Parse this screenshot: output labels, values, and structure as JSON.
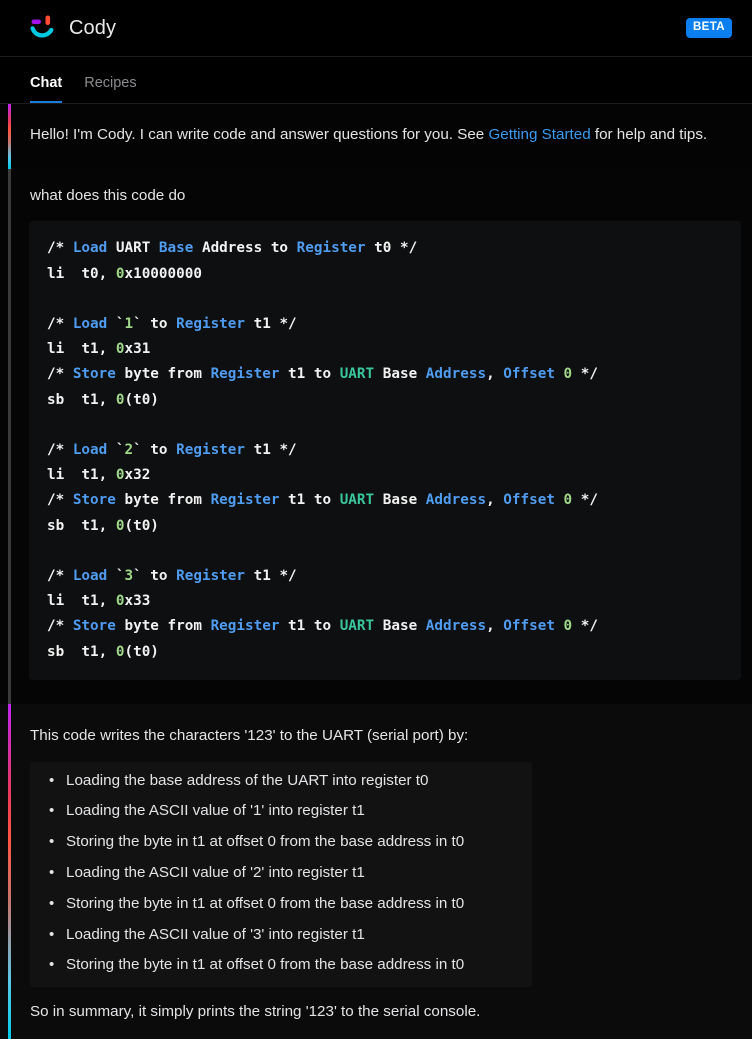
{
  "header": {
    "brand_name": "Cody",
    "logo_icon": "cody-smiley-icon",
    "badge_label": "BETA",
    "badge_color": "#0b7ff0"
  },
  "tabs": {
    "items": [
      {
        "label": "Chat",
        "active": true
      },
      {
        "label": "Recipes",
        "active": false
      }
    ],
    "active_underline_color": "#1d7ddb"
  },
  "greeting": {
    "text_before": "Hello! I'm Cody. I can write code and answer questions for you. See ",
    "link_label": "Getting Started",
    "link_color": "#3b9bf0",
    "text_after": " for help and tips.",
    "accent_gradient": [
      "#c026f0",
      "#ff5543",
      "#00cbec"
    ]
  },
  "user_message": {
    "query": "what does this code do",
    "accent_color": "#3b3b3e"
  },
  "code_block": {
    "language": "riscv-assembly",
    "background": "#0e0f10",
    "token_colors": {
      "keyword": "#4f9cf0",
      "type": "#39c69b",
      "number": "#9fd88a",
      "plain": "#f2f2f2"
    },
    "lines": [
      [
        {
          "t": "/* ",
          "c": "plain"
        },
        {
          "t": "Load",
          "c": "keyword"
        },
        {
          "t": " UART ",
          "c": "plain"
        },
        {
          "t": "Base",
          "c": "keyword"
        },
        {
          "t": " Address to ",
          "c": "plain"
        },
        {
          "t": "Register",
          "c": "keyword"
        },
        {
          "t": " t0 */",
          "c": "plain"
        }
      ],
      [
        {
          "t": "li  t0, ",
          "c": "plain"
        },
        {
          "t": "0",
          "c": "number"
        },
        {
          "t": "x10000000",
          "c": "plain"
        }
      ],
      [
        {
          "t": "",
          "c": "plain"
        }
      ],
      [
        {
          "t": "/* ",
          "c": "plain"
        },
        {
          "t": "Load",
          "c": "keyword"
        },
        {
          "t": " `",
          "c": "plain"
        },
        {
          "t": "1",
          "c": "number"
        },
        {
          "t": "` to ",
          "c": "plain"
        },
        {
          "t": "Register",
          "c": "keyword"
        },
        {
          "t": " t1 */",
          "c": "plain"
        }
      ],
      [
        {
          "t": "li  t1, ",
          "c": "plain"
        },
        {
          "t": "0",
          "c": "number"
        },
        {
          "t": "x31",
          "c": "plain"
        }
      ],
      [
        {
          "t": "/* ",
          "c": "plain"
        },
        {
          "t": "Store",
          "c": "keyword"
        },
        {
          "t": " byte from ",
          "c": "plain"
        },
        {
          "t": "Register",
          "c": "keyword"
        },
        {
          "t": " t1 to ",
          "c": "plain"
        },
        {
          "t": "UART",
          "c": "type"
        },
        {
          "t": " Base ",
          "c": "plain"
        },
        {
          "t": "Address",
          "c": "keyword"
        },
        {
          "t": ", ",
          "c": "plain"
        },
        {
          "t": "Offset",
          "c": "keyword"
        },
        {
          "t": " ",
          "c": "plain"
        },
        {
          "t": "0",
          "c": "number"
        },
        {
          "t": " */",
          "c": "plain"
        }
      ],
      [
        {
          "t": "sb  t1, ",
          "c": "plain"
        },
        {
          "t": "0",
          "c": "number"
        },
        {
          "t": "(t0)",
          "c": "plain"
        }
      ],
      [
        {
          "t": "",
          "c": "plain"
        }
      ],
      [
        {
          "t": "/* ",
          "c": "plain"
        },
        {
          "t": "Load",
          "c": "keyword"
        },
        {
          "t": " `",
          "c": "plain"
        },
        {
          "t": "2",
          "c": "number"
        },
        {
          "t": "` to ",
          "c": "plain"
        },
        {
          "t": "Register",
          "c": "keyword"
        },
        {
          "t": " t1 */",
          "c": "plain"
        }
      ],
      [
        {
          "t": "li  t1, ",
          "c": "plain"
        },
        {
          "t": "0",
          "c": "number"
        },
        {
          "t": "x32",
          "c": "plain"
        }
      ],
      [
        {
          "t": "/* ",
          "c": "plain"
        },
        {
          "t": "Store",
          "c": "keyword"
        },
        {
          "t": " byte from ",
          "c": "plain"
        },
        {
          "t": "Register",
          "c": "keyword"
        },
        {
          "t": " t1 to ",
          "c": "plain"
        },
        {
          "t": "UART",
          "c": "type"
        },
        {
          "t": " Base ",
          "c": "plain"
        },
        {
          "t": "Address",
          "c": "keyword"
        },
        {
          "t": ", ",
          "c": "plain"
        },
        {
          "t": "Offset",
          "c": "keyword"
        },
        {
          "t": " ",
          "c": "plain"
        },
        {
          "t": "0",
          "c": "number"
        },
        {
          "t": " */",
          "c": "plain"
        }
      ],
      [
        {
          "t": "sb  t1, ",
          "c": "plain"
        },
        {
          "t": "0",
          "c": "number"
        },
        {
          "t": "(t0)",
          "c": "plain"
        }
      ],
      [
        {
          "t": "",
          "c": "plain"
        }
      ],
      [
        {
          "t": "/* ",
          "c": "plain"
        },
        {
          "t": "Load",
          "c": "keyword"
        },
        {
          "t": " `",
          "c": "plain"
        },
        {
          "t": "3",
          "c": "number"
        },
        {
          "t": "` to ",
          "c": "plain"
        },
        {
          "t": "Register",
          "c": "keyword"
        },
        {
          "t": " t1 */",
          "c": "plain"
        }
      ],
      [
        {
          "t": "li  t1, ",
          "c": "plain"
        },
        {
          "t": "0",
          "c": "number"
        },
        {
          "t": "x33",
          "c": "plain"
        }
      ],
      [
        {
          "t": "/* ",
          "c": "plain"
        },
        {
          "t": "Store",
          "c": "keyword"
        },
        {
          "t": " byte from ",
          "c": "plain"
        },
        {
          "t": "Register",
          "c": "keyword"
        },
        {
          "t": " t1 to ",
          "c": "plain"
        },
        {
          "t": "UART",
          "c": "type"
        },
        {
          "t": " Base ",
          "c": "plain"
        },
        {
          "t": "Address",
          "c": "keyword"
        },
        {
          "t": ", ",
          "c": "plain"
        },
        {
          "t": "Offset",
          "c": "keyword"
        },
        {
          "t": " ",
          "c": "plain"
        },
        {
          "t": "0",
          "c": "number"
        },
        {
          "t": " */",
          "c": "plain"
        }
      ],
      [
        {
          "t": "sb  t1, ",
          "c": "plain"
        },
        {
          "t": "0",
          "c": "number"
        },
        {
          "t": "(t0)",
          "c": "plain"
        }
      ]
    ]
  },
  "answer": {
    "intro": "This code writes the characters '123' to the UART (serial port) by:",
    "bullets": [
      "Loading the base address of the UART into register t0",
      "Loading the ASCII value of '1' into register t1",
      "Storing the byte in t1 at offset 0 from the base address in t0",
      "Loading the ASCII value of '2' into register t1",
      "Storing the byte in t1 at offset 0 from the base address in t0",
      "Loading the ASCII value of '3' into register t1",
      "Storing the byte in t1 at offset 0 from the base address in t0"
    ],
    "summary": "So in summary, it simply prints the string '123' to the serial console.",
    "accent_gradient": [
      "#c026f0",
      "#ff5543",
      "#00cbec"
    ]
  }
}
